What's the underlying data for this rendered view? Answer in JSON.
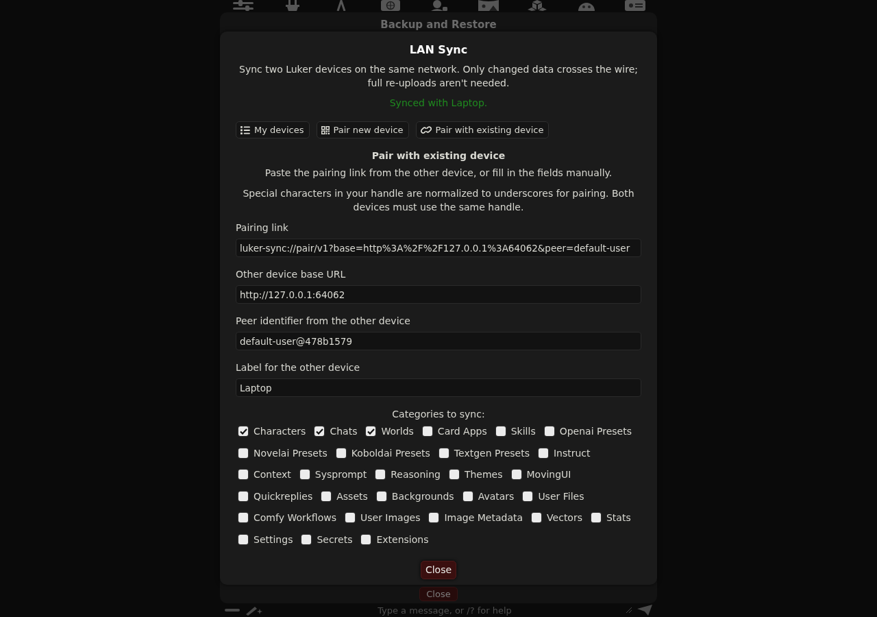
{
  "background": {
    "dialog_title": "Backup and Restore",
    "close_button": "Close",
    "message_input": {
      "placeholder": "Type a message, or /? for help"
    }
  },
  "dialog": {
    "title": "LAN Sync",
    "description": "Sync two Luker devices on the same network. Only changed data crosses the wire; full re-uploads aren't needed.",
    "status": {
      "text": "Synced with Laptop.",
      "kind": "success"
    },
    "tabs": [
      {
        "label": "My devices"
      },
      {
        "label": "Pair new device"
      },
      {
        "label": "Pair with existing device"
      }
    ],
    "section": {
      "title": "Pair with existing device",
      "instructions": "Paste the pairing link from the other device, or fill in the fields manually.",
      "note": "Special characters in your handle are normalized to underscores for pairing. Both devices must use the same handle."
    },
    "fields": [
      {
        "label": "Pairing link",
        "value": "luker-sync://pair/v1?base=http%3A%2F%2F127.0.0.1%3A64062&peer=default-user"
      },
      {
        "label": "Other device base URL",
        "value": "http://127.0.0.1:64062"
      },
      {
        "label": "Peer identifier from the other device",
        "value": "default-user@478b1579"
      },
      {
        "label": "Label for the other device",
        "value": "Laptop"
      }
    ],
    "categories": {
      "title": "Categories to sync:",
      "items": [
        {
          "label": "Characters",
          "checked": true
        },
        {
          "label": "Chats",
          "checked": true
        },
        {
          "label": "Worlds",
          "checked": true
        },
        {
          "label": "Card Apps",
          "checked": false
        },
        {
          "label": "Skills",
          "checked": false
        },
        {
          "label": "Openai Presets",
          "checked": false
        },
        {
          "label": "Novelai Presets",
          "checked": false
        },
        {
          "label": "Koboldai Presets",
          "checked": false
        },
        {
          "label": "Textgen Presets",
          "checked": false
        },
        {
          "label": "Instruct",
          "checked": false
        },
        {
          "label": "Context",
          "checked": false
        },
        {
          "label": "Sysprompt",
          "checked": false
        },
        {
          "label": "Reasoning",
          "checked": false
        },
        {
          "label": "Themes",
          "checked": false
        },
        {
          "label": "MovingUI",
          "checked": false
        },
        {
          "label": "Quickreplies",
          "checked": false
        },
        {
          "label": "Assets",
          "checked": false
        },
        {
          "label": "Backgrounds",
          "checked": false
        },
        {
          "label": "Avatars",
          "checked": false
        },
        {
          "label": "User Files",
          "checked": false
        },
        {
          "label": "Comfy Workflows",
          "checked": false
        },
        {
          "label": "User Images",
          "checked": false
        },
        {
          "label": "Image Metadata",
          "checked": false
        },
        {
          "label": "Vectors",
          "checked": false
        },
        {
          "label": "Stats",
          "checked": false
        },
        {
          "label": "Settings",
          "checked": false
        },
        {
          "label": "Secrets",
          "checked": false
        },
        {
          "label": "Extensions",
          "checked": false
        }
      ]
    },
    "close_button": "Close"
  }
}
